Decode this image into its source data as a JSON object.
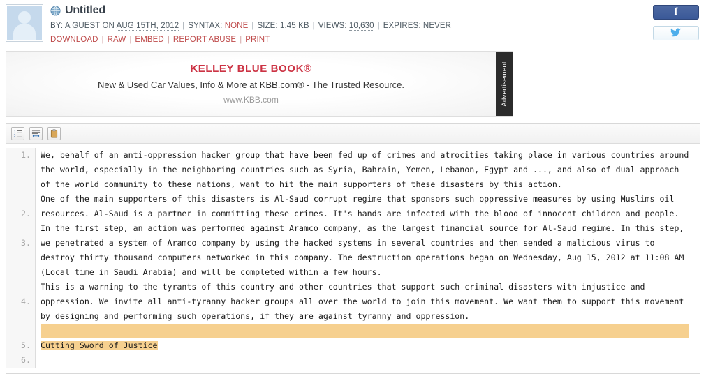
{
  "header": {
    "avatar_alt": "guest-avatar",
    "globe_icon": "globe-icon",
    "title": "Untitled",
    "meta": {
      "by_label": "BY:",
      "author": "A GUEST",
      "on_label": "ON",
      "date": "AUG 15TH, 2012",
      "syntax_label": "SYNTAX:",
      "syntax_value": "NONE",
      "size_label": "SIZE:",
      "size_value": "1.45 KB",
      "views_label": "VIEWS:",
      "views_value": "10,630",
      "expires_label": "EXPIRES:",
      "expires_value": "NEVER",
      "separator": "|"
    },
    "links": {
      "download": "DOWNLOAD",
      "raw": "RAW",
      "embed": "EMBED",
      "report_abuse": "REPORT ABUSE",
      "print": "PRINT",
      "separator": "|"
    },
    "social": {
      "facebook_glyph": "f",
      "facebook_name": "facebook-share-button",
      "twitter_glyph": "✉",
      "twitter_name": "twitter-share-button"
    }
  },
  "ad": {
    "title": "KELLEY BLUE BOOK®",
    "subtitle": "New & Used Car Values, Info & More at KBB.com® - The Trusted Resource.",
    "url": "www.KBB.com",
    "label": "Advertisement"
  },
  "toolbar": {
    "buttons": [
      {
        "name": "toggle-line-numbers-button",
        "icon": "list-numbered-icon"
      },
      {
        "name": "toggle-word-wrap-button",
        "icon": "word-wrap-icon"
      },
      {
        "name": "copy-to-clipboard-button",
        "icon": "clipboard-icon"
      }
    ]
  },
  "code": {
    "line_numbers": [
      "1.",
      "2.",
      "3.",
      "4.",
      "5.",
      "6."
    ],
    "lines": [
      "We, behalf of an anti-oppression hacker group that have been fed up of crimes and atrocities taking place in various countries around the world, especially in the neighboring countries such as Syria, Bahrain, Yemen, Lebanon, Egypt and ..., and also of dual approach of the world community to these nations, want to hit the main supporters of these disasters by this action.",
      "One of the main supporters of this disasters is Al-Saud corrupt regime that sponsors such oppressive measures by using Muslims oil resources. Al-Saud is a partner in committing these crimes. It's hands are infected with the blood of innocent children and people.",
      "In the first step, an action was performed against Aramco company, as the largest financial source for Al-Saud regime. In this step, we penetrated a system of Aramco company by using the hacked systems in several countries and then sended a malicious virus to destroy thirty thousand computers networked in this company. The destruction operations began on Wednesday, Aug 15, 2012 at 11:08 AM (Local time in Saudi Arabia) and will be completed within a few hours.",
      "This is a warning to the tyrants of this country and other countries that support such criminal disasters with injustice and oppression. We invite all anti-tyranny hacker groups all over the world to join this movement. We want them to support this movement by designing and performing such operations, if they are against tyranny and oppression.",
      "",
      "Cutting Sword of Justice"
    ],
    "highlight_color": "#f6d08f"
  }
}
